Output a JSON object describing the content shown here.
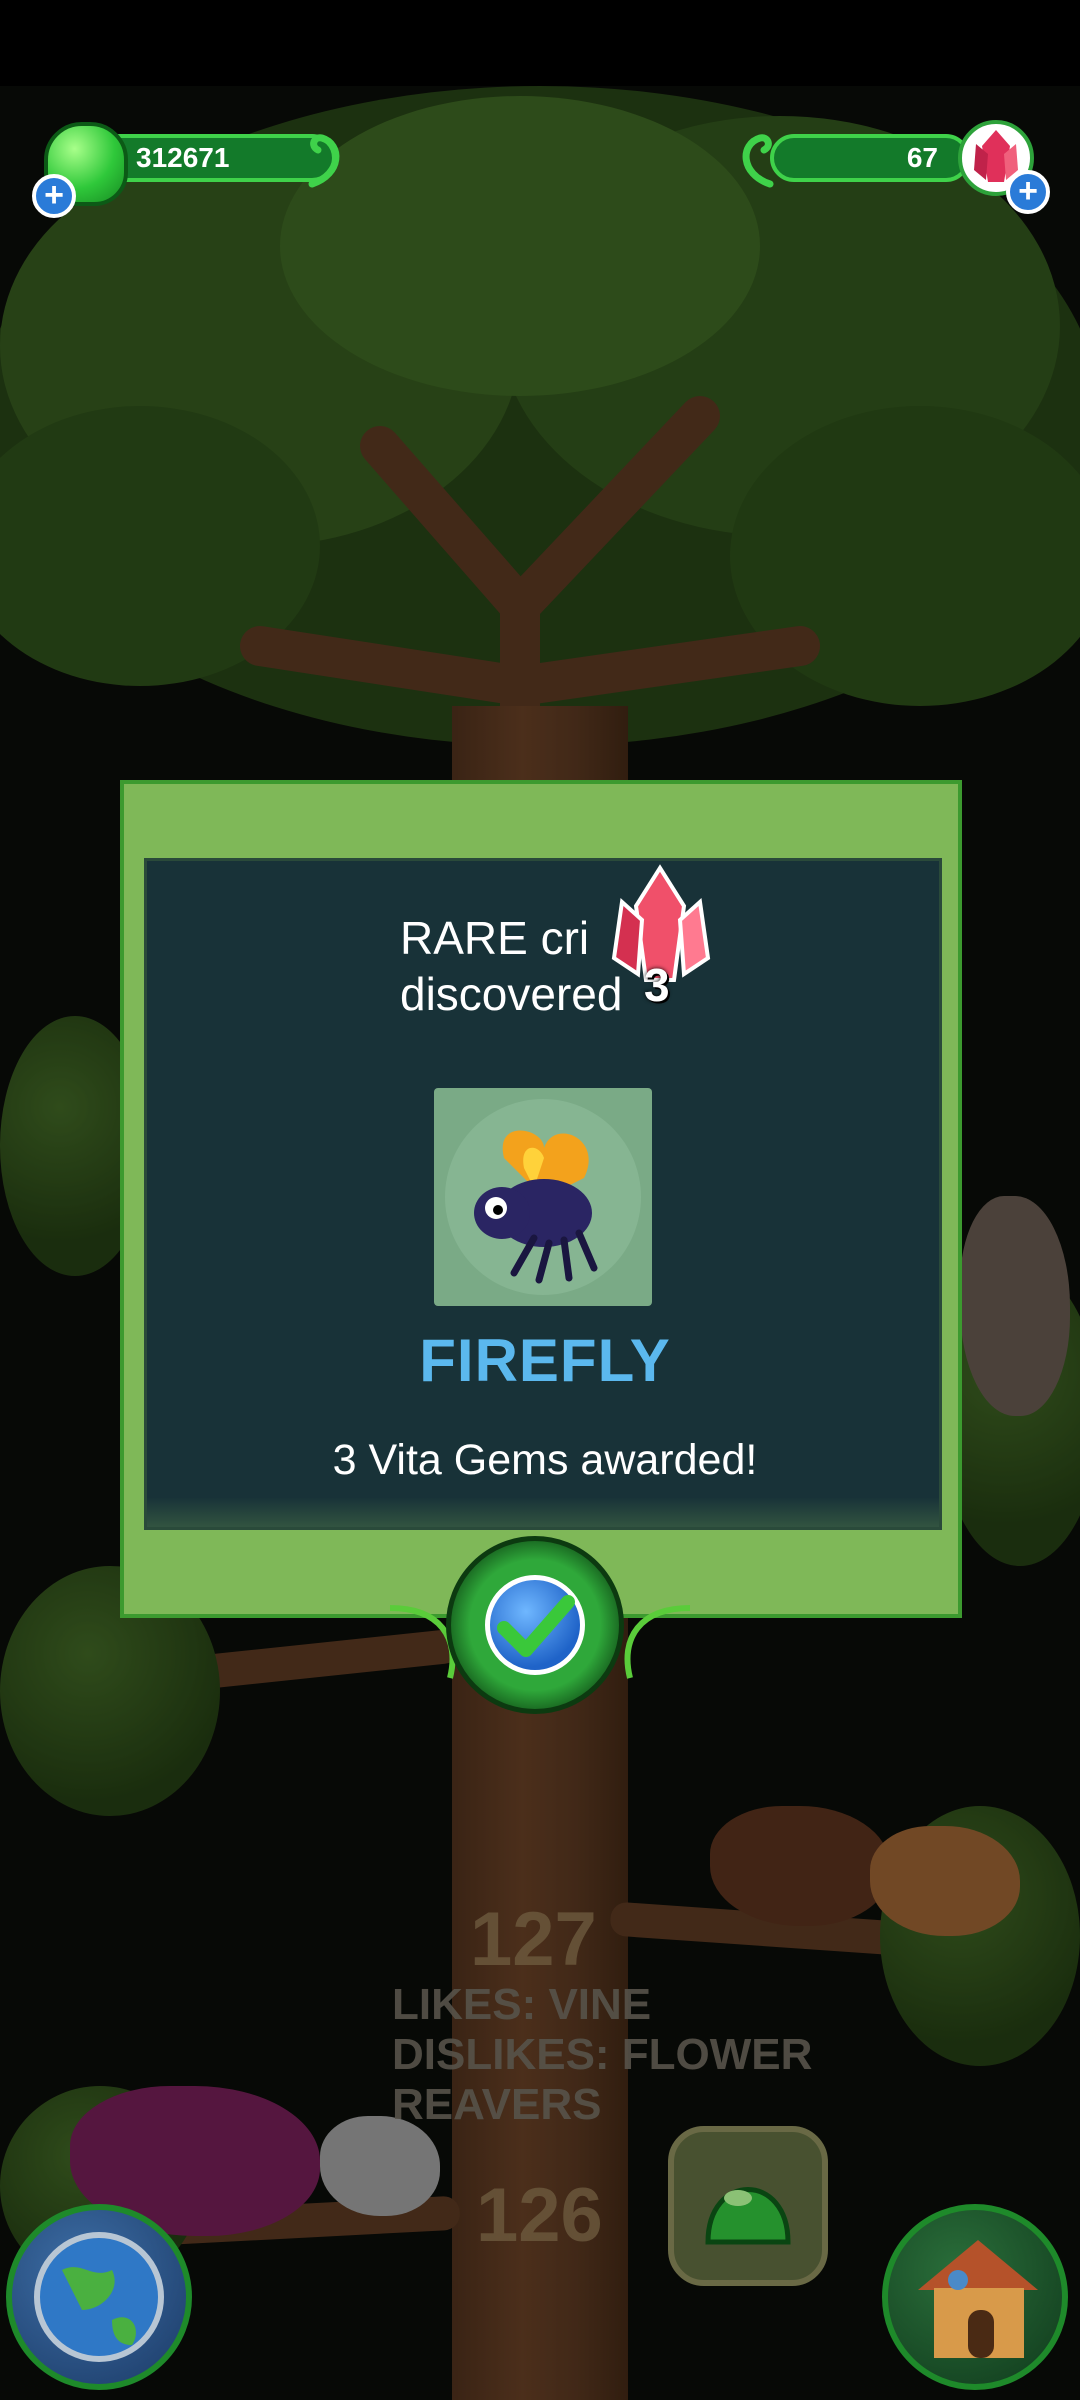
{
  "hud": {
    "jelly_count": "312671",
    "gem_count": "67"
  },
  "dialog": {
    "message": "RARE cri\ndiscovered",
    "reward_badge": "3",
    "critter_name": "FIREFLY",
    "award_text": "3 Vita Gems awarded!"
  },
  "tree": {
    "likes": "LIKES: VINE",
    "dislikes": "DISLIKES: FLOWER",
    "dislikes_cont": "REAVERS",
    "level_upper": "127",
    "level_lower": "126"
  },
  "colors": {
    "dialog_frame": "#7fb858",
    "dialog_panel": "#183238",
    "critter_name": "#5bb8ee",
    "hud_green": "#137a2a"
  },
  "icons": [
    "green-jelly-icon",
    "add-icon",
    "vine-icon",
    "red-gem-icon",
    "firefly-icon",
    "checkmark-icon",
    "globe-icon",
    "jelly-icon",
    "house-icon"
  ]
}
